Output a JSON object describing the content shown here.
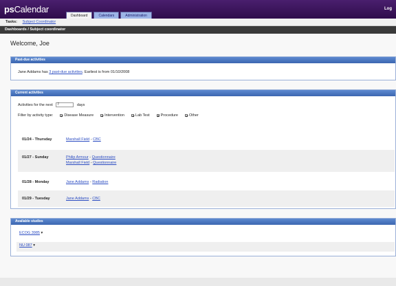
{
  "app": {
    "logo_bold": "ps",
    "logo_rest": "Calendar",
    "logout_label": "Log"
  },
  "tabs": [
    "Dashboard",
    "Calendars",
    "Administration"
  ],
  "role": {
    "label": "Tasks:",
    "value": "Subject Coordinator"
  },
  "breadcrumb": "Dashboards / Subject coordinator",
  "welcome": "Welcome, Joe",
  "past_due": {
    "title": "Past-due activities",
    "prefix": "Jane Addams has ",
    "link": "3 past-due activities",
    "suffix": ". Earliest is from 01/10/2008"
  },
  "current": {
    "title": "Current activities",
    "range_prefix": "Activities for the next",
    "range_value": "7",
    "range_suffix": "days",
    "filter_label": "Filter by activity type:",
    "filters": [
      "Disease Measure",
      "Intervention",
      "Lab Test",
      "Procedure",
      "Other"
    ],
    "rows": [
      {
        "date": "01/24 - Thursday",
        "items": [
          {
            "subject": "Marshall Field",
            "activity": "CBC"
          }
        ]
      },
      {
        "date": "01/27 - Sunday",
        "items": [
          {
            "subject": "Philip Armour",
            "activity": "Questionnaire"
          },
          {
            "subject": "Marshall Field",
            "activity": "Questionnaire"
          }
        ]
      },
      {
        "date": "01/28 - Monday",
        "items": [
          {
            "subject": "Jane Addams",
            "activity": "Radiation"
          }
        ]
      },
      {
        "date": "01/29 - Tuesday",
        "items": [
          {
            "subject": "Jane Addams",
            "activity": "CBC"
          }
        ]
      }
    ]
  },
  "studies": {
    "title": "Available studies",
    "items": [
      "ECOG 3985",
      "NU 087"
    ]
  }
}
